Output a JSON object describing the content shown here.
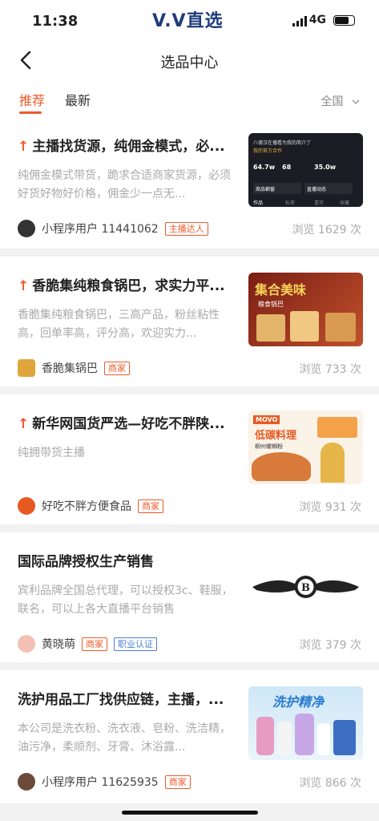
{
  "status": {
    "time": "11:38",
    "brand": "V.V直选",
    "network": "4G"
  },
  "nav": {
    "title": "选品中心"
  },
  "tabs": [
    {
      "label": "推荐"
    },
    {
      "label": "最新"
    }
  ],
  "region": {
    "label": "全国"
  },
  "cards": [
    {
      "title": "主播找货源，纯佣金模式，必...",
      "desc": "纯佣金模式带货，跪求合适商家货源，必须好货好物好价格，佣金少一点无...",
      "user": "小程序用户 11441062",
      "tags": [
        "主播达人"
      ],
      "views": "浏览 1629 次",
      "pinned": true
    },
    {
      "title": "香脆集纯粮食锅巴，求实力平...",
      "desc": "香脆集纯粮食锅巴，三高产品，粉丝粘性高，回单率高，评分高，欢迎实力...",
      "user": "香脆集锅巴",
      "tags": [
        "商家"
      ],
      "views": "浏览 733 次",
      "pinned": true
    },
    {
      "title": "新华网国货严选—好吃不胖陕...",
      "desc": "纯拥带货主播",
      "user": "好吃不胖方便食品",
      "tags": [
        "商家"
      ],
      "views": "浏览 931 次",
      "pinned": true
    },
    {
      "title": "国际品牌授权生产销售",
      "desc": "宾利品牌全国总代理，可以授权3c、鞋服，联名，可以上各大直播平台销售",
      "user": "黄晓萌",
      "tags": [
        "商家",
        "职业认证"
      ],
      "views": "浏览 379 次",
      "pinned": false
    },
    {
      "title": "洗护用品工厂找供应链，主播，...",
      "desc": "本公司是洗衣粉、洗衣液、皂粉、洗洁精，油污净，柔顺剂、牙膏、沐浴露...",
      "user": "小程序用户 11625935",
      "tags": [
        "商家"
      ],
      "views": "浏览 866 次",
      "pinned": false
    }
  ],
  "thumbs": {
    "t0": {
      "name": "八德汉在播看为我的简介了",
      "sub": "我的官方合作",
      "s1": "64.7w",
      "s2": "68",
      "s3": "35.0w",
      "l1": "获赞",
      "l2": "关注",
      "l3": "粉丝",
      "b1": "商品橱窗",
      "b2": "直播动态",
      "tab1": "作品",
      "tab2": "私密",
      "tab3": "喜欢",
      "tab4": "收藏"
    },
    "t1": {
      "big": "集合美味",
      "sub": "粮食锅巴"
    },
    "t2": {
      "logo": "MOVO",
      "big": "低碳料理",
      "sub": "柳州螺蛳粉"
    },
    "t4": {
      "big": "洗护精净"
    }
  }
}
